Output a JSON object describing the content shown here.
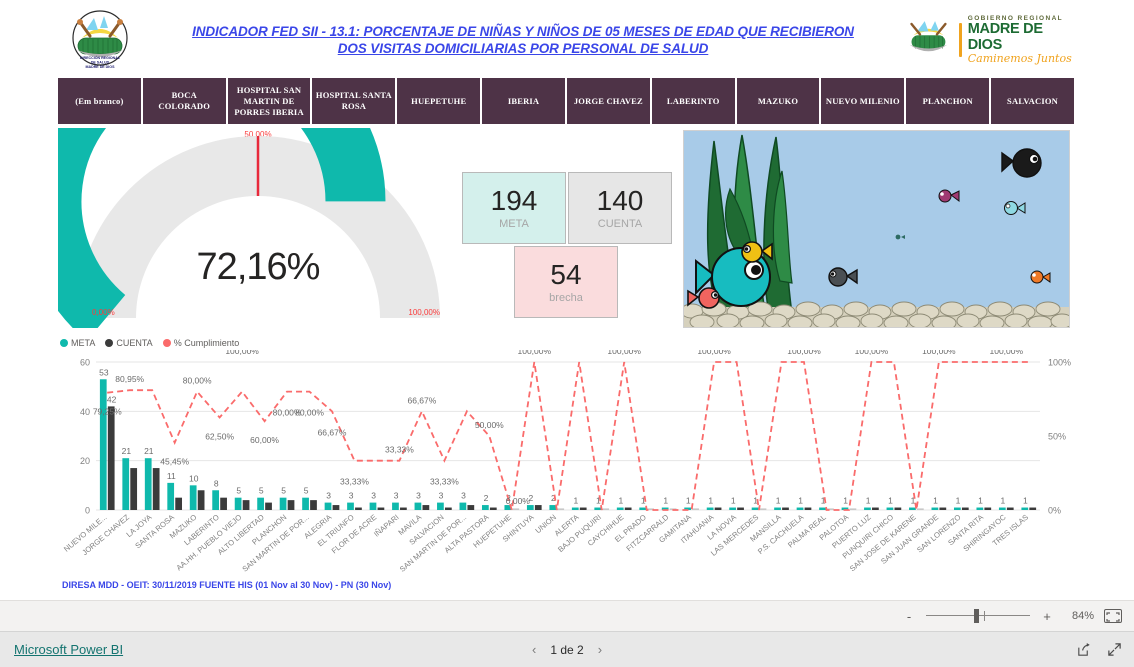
{
  "header": {
    "title_line1": "INDICADOR FED SII - 13.1: PORCENTAJE DE NIÑAS Y NIÑOS DE 05 MESES DE EDAD QUE RECIBIERON",
    "title_line2": "DOS VISITAS DOMICILIARIAS POR PERSONAL DE SALUD",
    "left_logo_name": "diresa-madre-de-dios-logo",
    "left_logo_line1": "DIRECCIÓN REGIONAL",
    "left_logo_line2": "DE SALUD",
    "left_logo_line3": "MADRE DE DIOS",
    "right_logo_line1": "GOBIERNO REGIONAL",
    "right_logo_line2": "MADRE DE DIOS",
    "right_logo_line3": "Caminemos Juntos"
  },
  "tabs": [
    "(Em branco)",
    "BOCA COLORADO",
    "HOSPITAL SAN MARTIN DE PORRES IBERIA",
    "HOSPITAL SANTA ROSA",
    "HUEPETUHE",
    "IBERIA",
    "JORGE CHAVEZ",
    "LABERINTO",
    "MAZUKO",
    "NUEVO MILENIO",
    "PLANCHON",
    "SALVACION"
  ],
  "gauge": {
    "value_label": "72,16%",
    "value": 72.16,
    "min_label": "0,00%",
    "max_label": "100,00%",
    "target_label": "50,00%",
    "target": 50,
    "min": 0,
    "max": 100,
    "fill_color": "#0fb9ac",
    "track_color": "#e8e8e8",
    "target_color": "#e8293b"
  },
  "kpis": [
    {
      "name": "meta",
      "value": "194",
      "label": "META",
      "bg": "#d4f0ec"
    },
    {
      "name": "cuenta",
      "value": "140",
      "label": "CUENTA",
      "bg": "#e6e6e6"
    },
    {
      "name": "brecha",
      "value": "54",
      "label": "brecha",
      "bg": "#fadcdd"
    }
  ],
  "aquarium": {
    "name": "aquarium-fish-image",
    "water_color": "#a8cbe8",
    "gravel_color": "#d6d1bd",
    "plant_color": "#2e8b46",
    "plant_dark_color": "#1f6b33"
  },
  "note": "DIRESA MDD - OEIT: 30/11/2019 FUENTE HIS (01 Nov al 30 Nov) - PN (30 Nov)",
  "zoom": {
    "level": "84%",
    "minus": "-",
    "plus": "+",
    "fit_icon": "fit-to-page-icon"
  },
  "bottom": {
    "brand": "Microsoft Power BI",
    "page_label": "1 de 2",
    "prev_icon": "chevron-left-icon",
    "next_icon": "chevron-right-icon",
    "share_icon": "share-icon",
    "fullscreen_icon": "fullscreen-icon"
  },
  "chart_data": {
    "type": "bar",
    "title": "",
    "xlabel": "",
    "ylabel": "",
    "ylim": [
      0,
      60
    ],
    "y_ticks": [
      0,
      20,
      40,
      60
    ],
    "y2lim": [
      0,
      100
    ],
    "y2_ticks": [
      "0%",
      "50%",
      "100%"
    ],
    "grid": true,
    "legend_position": "top-left",
    "legend": [
      {
        "name": "META",
        "color": "#0fb9ac"
      },
      {
        "name": "CUENTA",
        "color": "#3b3b3b"
      },
      {
        "name": "% Cumplimiento",
        "color": "#fa6b6b"
      }
    ],
    "categories": [
      "NUEVO MILE...",
      "JORGE CHAVEZ",
      "LA JOYA",
      "SANTA ROSA",
      "MAZUKO",
      "LABERINTO",
      "AA.HH. PUEBLO VIEJO",
      "ALTO LIBERTAD",
      "PLANCHON",
      "SAN MARTIN DE POR...",
      "ALEGRIA",
      "EL TRIUNFO",
      "FLOR DE ACRE",
      "IÑAPARI",
      "MAVILA",
      "SALVACION",
      "SAN MARTIN DE POR...",
      "ALTA PASTORA",
      "HUEPETUHE",
      "SHINTUYA",
      "UNION",
      "ALERTA",
      "BAJO PUQUIRI",
      "CAYCHIHUE",
      "EL PRADO",
      "FITZCARRALD",
      "GAMITANA",
      "ITAHUANIA",
      "LA NOVIA",
      "LAS MERCEDES",
      "MANSILLA",
      "P.S. CACHUELA",
      "PALMA REAL",
      "PALOTOA",
      "PUERTO LUZ",
      "PUNQUIRI CHICO",
      "SAN JOSE DE KARENE",
      "SAN JUAN GRANDE",
      "SAN LORENZO",
      "SANTA RITA",
      "SHIRINGAYOC",
      "TRES ISLAS"
    ],
    "series": [
      {
        "name": "META",
        "color": "#0fb9ac",
        "axis": "left",
        "values": [
          53,
          21,
          21,
          11,
          10,
          8,
          5,
          5,
          5,
          5,
          3,
          3,
          3,
          3,
          3,
          3,
          3,
          2,
          2,
          2,
          2,
          1,
          1,
          1,
          1,
          1,
          1,
          1,
          1,
          1,
          1,
          1,
          1,
          1,
          1,
          1,
          1,
          1,
          1,
          1,
          1,
          1
        ]
      },
      {
        "name": "CUENTA",
        "color": "#3b3b3b",
        "axis": "left",
        "values": [
          42,
          17,
          17,
          5,
          8,
          5,
          4,
          3,
          4,
          4,
          2,
          1,
          1,
          1,
          2,
          1,
          2,
          1,
          0,
          2,
          0,
          1,
          0,
          1,
          0,
          0,
          0,
          1,
          1,
          0,
          1,
          1,
          0,
          0,
          1,
          1,
          0,
          1,
          1,
          1,
          1,
          1
        ]
      },
      {
        "name": "% Cumplimiento",
        "color": "#fa6b6b",
        "axis": "right",
        "values": [
          79.25,
          80.95,
          80.95,
          45.45,
          80.0,
          62.5,
          80.0,
          60.0,
          80.0,
          80.0,
          66.67,
          33.33,
          33.33,
          33.33,
          66.67,
          33.33,
          66.67,
          50.0,
          0.0,
          100.0,
          0.0,
          100.0,
          0.0,
          100.0,
          0.0,
          0.0,
          0.0,
          100.0,
          100.0,
          0.0,
          100.0,
          100.0,
          0.0,
          0.0,
          100.0,
          100.0,
          0.0,
          100.0,
          100.0,
          100.0,
          100.0,
          100.0
        ]
      }
    ],
    "bar_labels": [
      "53",
      "21",
      "21",
      "11",
      "10",
      "8",
      "5",
      "5",
      "5",
      "5",
      "3",
      "3",
      "3",
      "3",
      "3",
      "3",
      "3",
      "2",
      "2",
      "2",
      "2",
      "1",
      "1",
      "1",
      "1",
      "1",
      "1",
      "1",
      "1",
      "1",
      "1",
      "1",
      "1",
      "1",
      "1",
      "1",
      "1",
      "1",
      "1",
      "1",
      "1",
      "1"
    ],
    "cuenta_labels": [
      "42"
    ],
    "line_labels": [
      "79,25%",
      "80,95%",
      "45,45%",
      "80,00%",
      "62,50%",
      "100,00%",
      "80,00%",
      "60,00%",
      "80,00%",
      "80,00%",
      "66,67%",
      "33,33%",
      "33,33%",
      "66,67%",
      "33,33%",
      "50,00%",
      "100,00%",
      "0,00%",
      "100,00%",
      "100,00%",
      "100,00%",
      "100,00%",
      "100,00%",
      "100,00%"
    ]
  }
}
